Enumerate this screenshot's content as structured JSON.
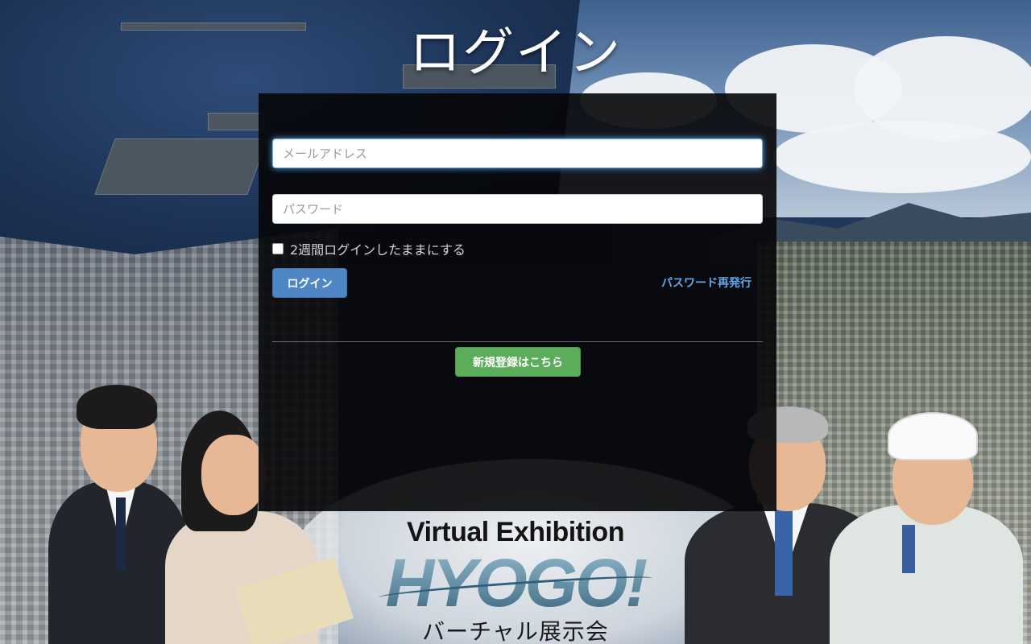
{
  "page": {
    "title": "ログイン"
  },
  "login_form": {
    "email_placeholder": "メールアドレス",
    "password_placeholder": "パスワード",
    "remember_label": "2週間ログインしたままにする",
    "remember_checked": false,
    "login_button": "ログイン",
    "forgot_password_link": "パスワード再発行",
    "register_button": "新規登録はこちら"
  },
  "brand": {
    "english": "Virtual Exhibition",
    "logo": "HYOGO!",
    "japanese": "バーチャル展示会"
  },
  "colors": {
    "login_button": "#4f86c6",
    "register_button": "#5cad5a",
    "link": "#66a7e6",
    "panel": "#060608"
  }
}
